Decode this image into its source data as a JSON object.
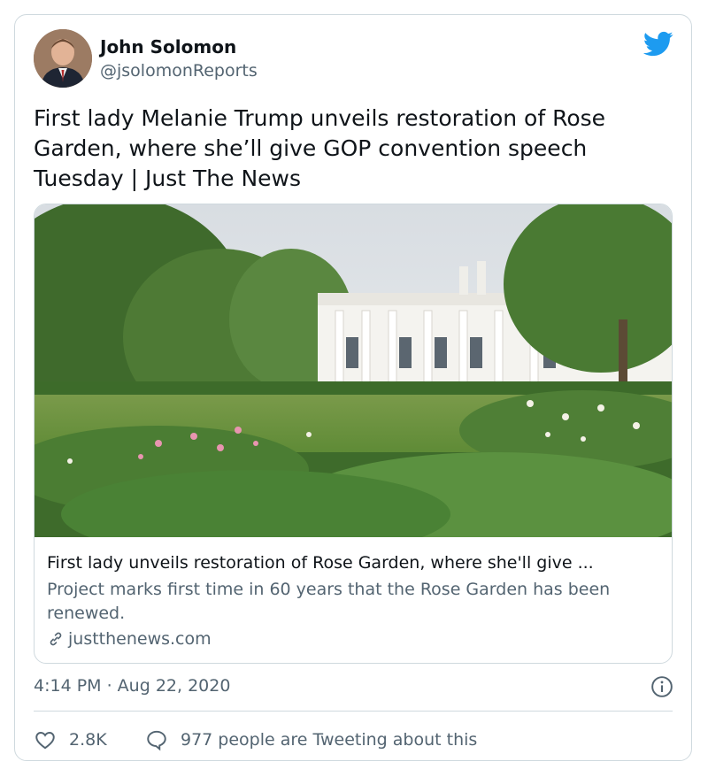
{
  "author": {
    "name": "John Solomon",
    "handle": "@jsolomonReports"
  },
  "tweet": {
    "text": "First lady Melanie Trump unveils restoration of Rose Garden, where she’ll give GOP convention speech Tuesday | Just The News",
    "timestamp": "4:14 PM · Aug 22, 2020"
  },
  "link_card": {
    "title": "First lady unveils restoration of Rose Garden, where she'll give ...",
    "description": "Project marks first time in 60 years that the Rose Garden has been renewed.",
    "domain": "justthenews.com"
  },
  "actions": {
    "like_count": "2.8K",
    "reply_text": "977 people are Tweeting about this"
  },
  "icons": {
    "brand": "twitter-bird-icon",
    "info": "info-icon",
    "link": "link-icon",
    "like": "heart-icon",
    "reply": "speech-bubble-icon"
  },
  "colors": {
    "brand_blue": "#1d9bf0",
    "text_primary": "#0f1419",
    "text_secondary": "#536471",
    "border": "#cfd9de"
  }
}
